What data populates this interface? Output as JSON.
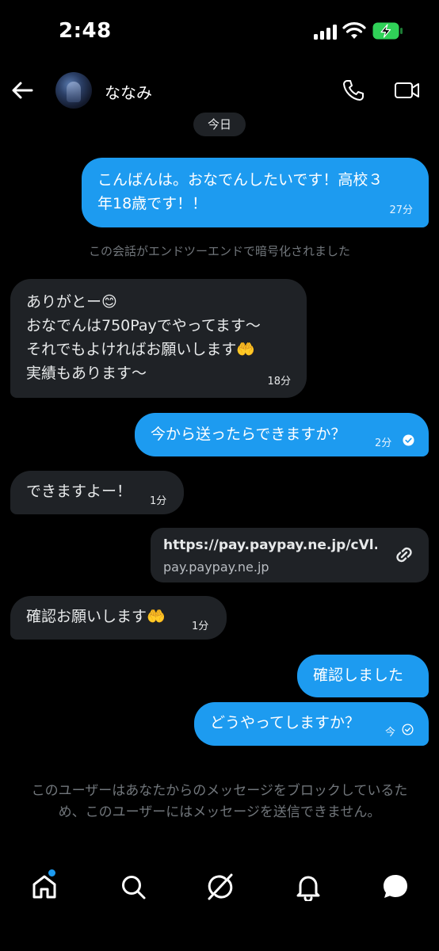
{
  "status_bar": {
    "time": "2:48"
  },
  "header": {
    "contact_name": "ななみ"
  },
  "date_divider": "今日",
  "messages": [
    {
      "direction": "out",
      "text": "こんばんは。おなでんしたいです！高校３\n年18歳です！！",
      "time": "27分"
    },
    {
      "direction": "in",
      "text": "ありがとー😊\nおなでんは750Payでやってます〜\nそれでもよければお願いします🤲\n実績もあります〜",
      "time": "18分"
    },
    {
      "direction": "out",
      "text": "今から送ったらできますか？",
      "time": "2分",
      "status": "read"
    },
    {
      "direction": "in",
      "text": "できますよー！",
      "time": "1分"
    },
    {
      "direction": "in",
      "text": "確認お願いします🤲",
      "time": "1分"
    },
    {
      "direction": "out",
      "text": "確認しました"
    },
    {
      "direction": "out",
      "text": "どうやってしますか？",
      "time": "今",
      "status": "sent"
    }
  ],
  "encryption_note": "この会話がエンドツーエンドで暗号化されました",
  "link_card": {
    "title": "https://pay.paypay.ne.jp/cVl...",
    "domain": "pay.paypay.ne.jp",
    "icon": "link-icon"
  },
  "blocked_note": "このユーザーはあなたからのメッセージをブロックしているため、このユーザーにはメッセージを送信できません。",
  "bottom_nav": [
    {
      "name": "home",
      "icon": "home-icon",
      "notification_dot": true
    },
    {
      "name": "search",
      "icon": "search-icon"
    },
    {
      "name": "grok",
      "icon": "grok-icon"
    },
    {
      "name": "notifications",
      "icon": "bell-icon"
    },
    {
      "name": "messages",
      "icon": "chat-bubble-icon"
    }
  ],
  "colors": {
    "background": "#000000",
    "outgoing_bubble": "#1d9bf0",
    "incoming_bubble": "#1f2226",
    "muted_text": "#71767b",
    "battery_charging": "#30d158"
  }
}
